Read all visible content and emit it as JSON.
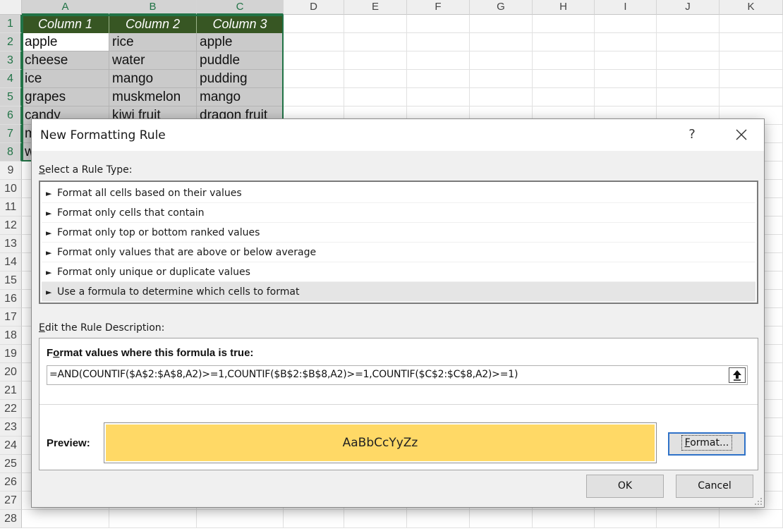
{
  "spreadsheet": {
    "columns": [
      "A",
      "B",
      "C",
      "D",
      "E",
      "F",
      "G",
      "H",
      "I",
      "J",
      "K"
    ],
    "rows": [
      "1",
      "2",
      "3",
      "4",
      "5",
      "6",
      "7",
      "8",
      "9",
      "10",
      "11",
      "12",
      "13",
      "14",
      "15",
      "16",
      "17",
      "18",
      "19",
      "20",
      "21",
      "22",
      "23",
      "24",
      "25",
      "26",
      "27",
      "28"
    ],
    "headers": [
      "Column 1",
      "Column 2",
      "Column 3"
    ],
    "data": [
      [
        "apple",
        "rice",
        "apple"
      ],
      [
        "cheese",
        "water",
        "puddle"
      ],
      [
        "ice",
        "mango",
        "pudding"
      ],
      [
        "grapes",
        "muskmelon",
        "mango"
      ],
      [
        "candy",
        "kiwi fruit",
        "dragon fruit"
      ],
      [
        "m",
        "",
        ""
      ],
      [
        "w",
        "",
        ""
      ]
    ],
    "header_color": "#375623",
    "highlight_color": "#cacaca",
    "selection_color": "#217346"
  },
  "dialog": {
    "title": "New Formatting Rule",
    "help_label": "?",
    "close_icon": "close-icon",
    "select_rule_type_label_accel": "S",
    "select_rule_type_label_rest": "elect a Rule Type:",
    "rule_types": [
      "Format all cells based on their values",
      "Format only cells that contain",
      "Format only top or bottom ranked values",
      "Format only values that are above or below average",
      "Format only unique or duplicate values",
      "Use a formula to determine which cells to format"
    ],
    "selected_rule_index": 5,
    "rule_arrow_glyph": "►",
    "edit_description_label_accel": "E",
    "edit_description_label_rest": "dit the Rule Description:",
    "formula_label_pre": "F",
    "formula_label_accel": "o",
    "formula_label_rest": "rmat values where this formula is true:",
    "formula_value": "=AND(COUNTIF($A$2:$A$8,A2)>=1,COUNTIF($B$2:$B$8,A2)>=1,COUNTIF($C$2:$C$8,A2)>=1)",
    "preview_label": "Preview:",
    "preview_text": "AaBbCcYyZz",
    "preview_fill_color": "#ffd966",
    "format_button_accel": "F",
    "format_button_rest": "ormat...",
    "ok_label": "OK",
    "cancel_label": "Cancel"
  }
}
